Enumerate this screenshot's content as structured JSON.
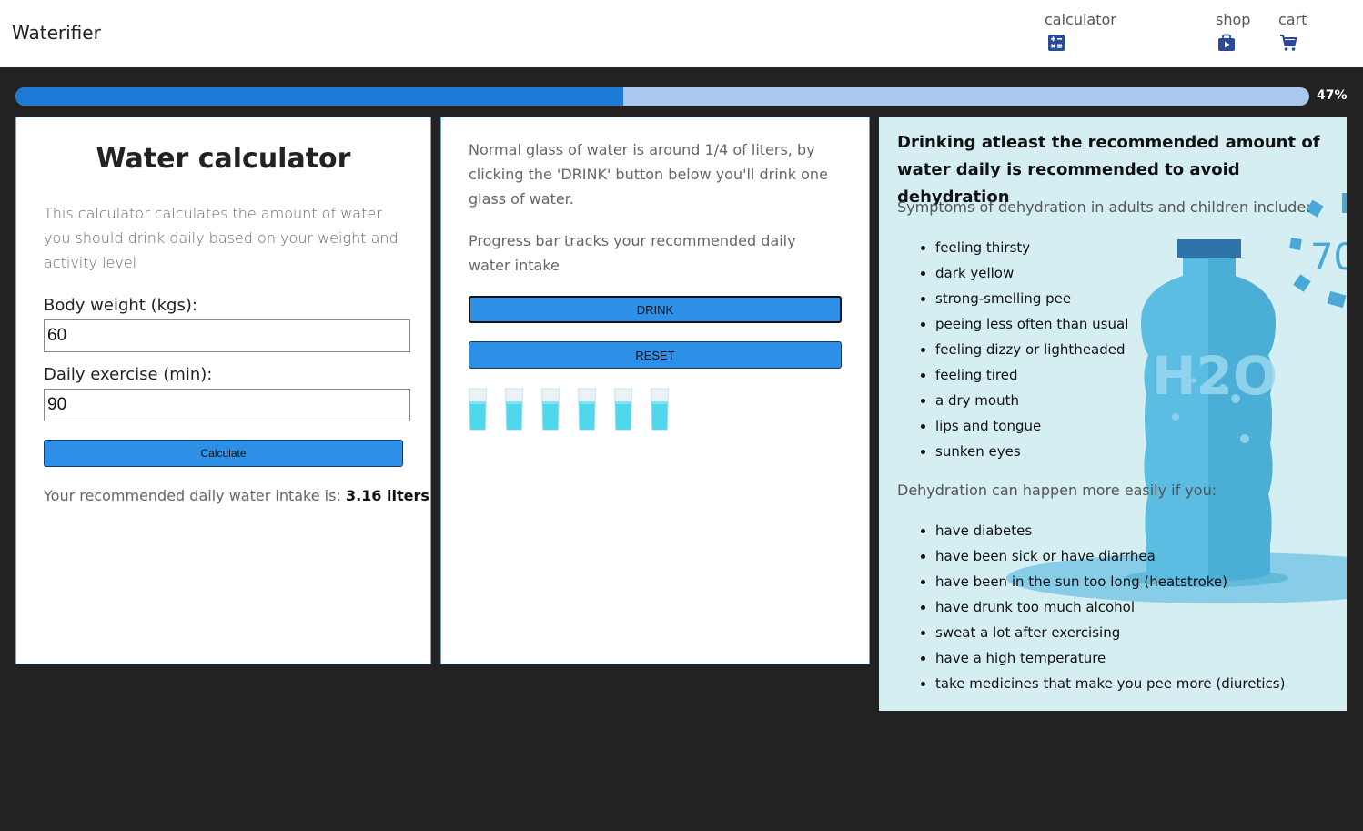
{
  "header": {
    "brand": "Waterifier",
    "nav": [
      {
        "label": "calculator",
        "icon": "calculator-icon"
      },
      {
        "label": "shop",
        "icon": "shop-icon"
      },
      {
        "label": "cart",
        "icon": "cart-icon"
      }
    ]
  },
  "progress": {
    "value": 47,
    "label": "47%"
  },
  "calculator": {
    "title": "Water calculator",
    "description": "This calculator calculates the amount of water you should drink daily based on your weight and activity level",
    "weight_label": "Body weight (kgs):",
    "weight_value": "60",
    "exercise_label": "Daily exercise (min):",
    "exercise_value": "90",
    "button_label": "Calculate",
    "result_prefix": "Your recommended daily water intake is:",
    "result_value": "3.16 liters"
  },
  "tracker": {
    "text1": "Normal glass of water is around 1/4 of liters, by clicking the 'DRINK' button below you'll drink one glass of water.",
    "text2": "Progress bar tracks your recommended daily water intake",
    "drink_label": "DRINK",
    "reset_label": "RESET",
    "glasses_count": 6
  },
  "info": {
    "title": "Drinking atleast the recommended amount of water daily is recommended to avoid dehydration",
    "symptoms_heading": "Symptoms of dehydration in adults and children include:",
    "symptoms": [
      "feeling thirsty",
      "dark yellow",
      "strong-smelling pee",
      "peeing less often than usual",
      "feeling dizzy or lightheaded",
      "feeling tired",
      "a dry mouth",
      "lips and tongue",
      "sunken eyes"
    ],
    "causes_heading": "Dehydration can happen more easily if you:",
    "causes": [
      "have diabetes",
      "have been sick or have diarrhea",
      "have been in the sun too long (heatstroke)",
      "have drunk too much alcohol",
      "sweat a lot after exercising",
      "have a high temperature",
      "take medicines that make you pee more (diuretics)"
    ],
    "bottle_logo": "H2O",
    "bottle_badge": "70"
  },
  "colors": {
    "accent": "#2e8fe6",
    "progress_fill": "#1e78d6",
    "progress_track": "#a8c8ee",
    "water": "#4fd8ec",
    "info_bg": "#d4eef1"
  }
}
